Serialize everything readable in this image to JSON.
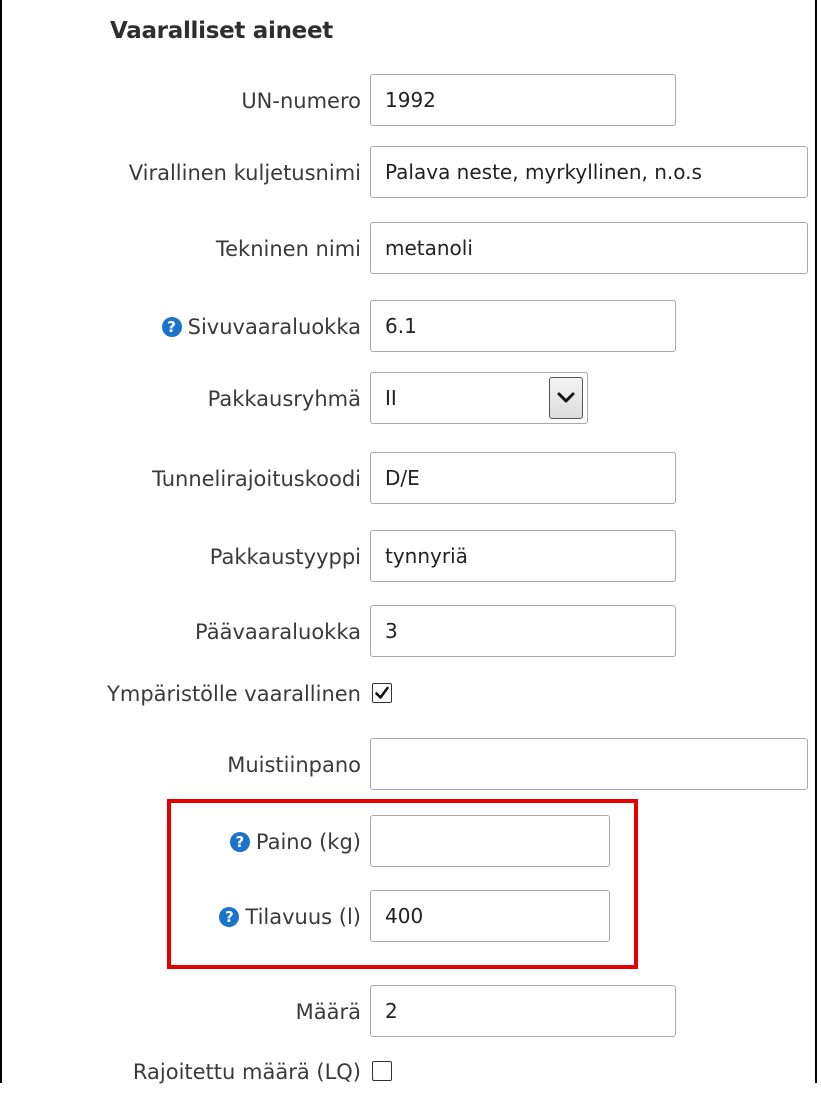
{
  "section": {
    "title": "Vaaralliset aineet"
  },
  "fields": {
    "un_number": {
      "label": "UN-numero",
      "value": "1992"
    },
    "shipping_name": {
      "label": "Virallinen kuljetusnimi",
      "value": "Palava neste, myrkyllinen, n.o.s"
    },
    "technical_name": {
      "label": "Tekninen nimi",
      "value": "metanoli"
    },
    "subsidiary_class": {
      "label": "Sivuvaaraluokka",
      "value": "6.1"
    },
    "packing_group": {
      "label": "Pakkausryhmä",
      "value": "II"
    },
    "tunnel_code": {
      "label": "Tunnelirajoituskoodi",
      "value": "D/E"
    },
    "package_type": {
      "label": "Pakkaustyyppi",
      "value": "tynnyriä"
    },
    "primary_class": {
      "label": "Päävaaraluokka",
      "value": "3"
    },
    "env_hazard": {
      "label": "Ympäristölle vaarallinen",
      "checked": true
    },
    "note": {
      "label": "Muistiinpano",
      "value": ""
    },
    "weight": {
      "label": "Paino (kg)",
      "value": ""
    },
    "volume": {
      "label": "Tilavuus (l)",
      "value": "400"
    },
    "quantity": {
      "label": "Määrä",
      "value": "2"
    },
    "limited_quantity": {
      "label": "Rajoitettu määrä (LQ)",
      "checked": false
    }
  },
  "colors": {
    "help_icon": "#1b74c9",
    "highlight": "#e60000"
  }
}
